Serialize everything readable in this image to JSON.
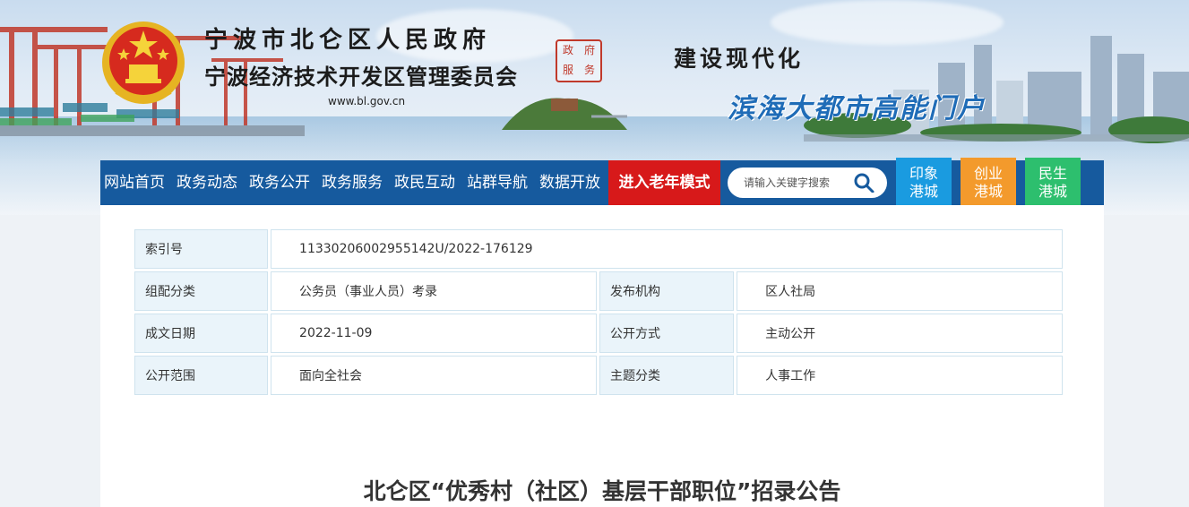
{
  "header": {
    "title_line1": "宁波市北仑区人民政府",
    "title_line2": "宁波经济技术开发区管理委员会",
    "site_url": "www.bl.gov.cn",
    "seal_chars": [
      "政",
      "府",
      "服",
      "务"
    ],
    "slogan_line1": "建设现代化",
    "slogan_line2": "滨海大都市高能门户",
    "emblem_icon": "national-emblem-icon"
  },
  "nav": {
    "items": [
      "网站首页",
      "政务动态",
      "政务公开",
      "政务服务",
      "政民互动",
      "站群导航",
      "数据开放"
    ],
    "elder_mode": "进入老年模式",
    "search_placeholder": "请输入关键字搜索",
    "search_icon": "search-icon",
    "side_buttons": [
      {
        "line1": "印象",
        "line2": "港城",
        "color": "#1a9be0"
      },
      {
        "line1": "创业",
        "line2": "港城",
        "color": "#f39a2c"
      },
      {
        "line1": "民生",
        "line2": "港城",
        "color": "#2dbf6e"
      }
    ],
    "bar_color": "#165a9e",
    "elder_color": "#d7191a"
  },
  "meta": {
    "index_label": "索引号",
    "index_value": "11330206002955142U/2022-176129",
    "category_label": "组配分类",
    "category_value": "公务员（事业人员）考录",
    "publisher_label": "发布机构",
    "publisher_value": "区人社局",
    "date_label": "成文日期",
    "date_value": "2022-11-09",
    "method_label": "公开方式",
    "method_value": "主动公开",
    "scope_label": "公开范围",
    "scope_value": "面向全社会",
    "topic_label": "主题分类",
    "topic_value": "人事工作"
  },
  "article": {
    "title": "北仑区“优秀村（社区）基层干部职位”招录公告"
  }
}
